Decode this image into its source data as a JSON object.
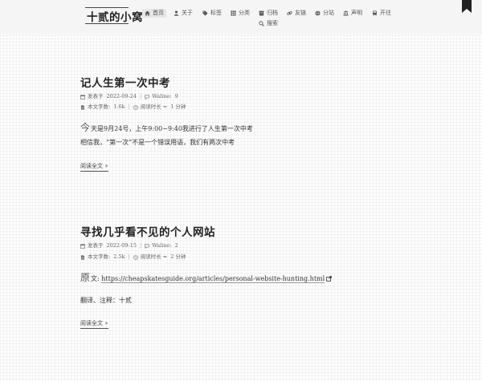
{
  "site": {
    "logo": "十贰的小窝"
  },
  "nav": [
    {
      "id": "home",
      "label": "首页",
      "icon": "home-icon"
    },
    {
      "id": "about",
      "label": "关于",
      "icon": "user-icon"
    },
    {
      "id": "tags",
      "label": "标签",
      "icon": "tag-icon"
    },
    {
      "id": "categories",
      "label": "分类",
      "icon": "grid-icon"
    },
    {
      "id": "archives",
      "label": "归档",
      "icon": "archive-icon"
    },
    {
      "id": "friends",
      "label": "友链",
      "icon": "link-icon"
    },
    {
      "id": "sitemap",
      "label": "分站",
      "icon": "globe-icon"
    },
    {
      "id": "statement",
      "label": "声明",
      "icon": "bank-icon"
    },
    {
      "id": "subscribe",
      "label": "开往",
      "icon": "subway-icon"
    },
    {
      "id": "search",
      "label": "搜索",
      "icon": "search-icon"
    }
  ],
  "posts": [
    {
      "title": "记人生第一次中考",
      "published_label": "发表于",
      "published": "2022-09-24",
      "comments_label": "Waline:",
      "comments": "9",
      "wordcount_label": "本文字数:",
      "wordcount": "1.6k",
      "readtime_label": "阅读时长 ≈",
      "readtime": "1 分钟",
      "dropcap": "今",
      "line1": "天是9月24号，上午9:00~9:40我进行了人生第一次中考",
      "line2": "相信我，“第一次”不是一个错误用语，我们有两次中考",
      "read_more": "阅读全文 »"
    },
    {
      "title": "寻找几乎看不见的个人网站",
      "published_label": "发表于",
      "published": "2022-09-15",
      "comments_label": "Waline:",
      "comments": "2",
      "wordcount_label": "本文字数:",
      "wordcount": "2.5k",
      "readtime_label": "阅读时长 ≈",
      "readtime": "2 分钟",
      "dropcap": "原",
      "line1_prefix": "文:",
      "line1_link": "https://cheapskatesguide.org/articles/personal-website-hunting.html",
      "line2": "翻译、注释：十贰",
      "read_more": "阅读全文 »"
    }
  ]
}
